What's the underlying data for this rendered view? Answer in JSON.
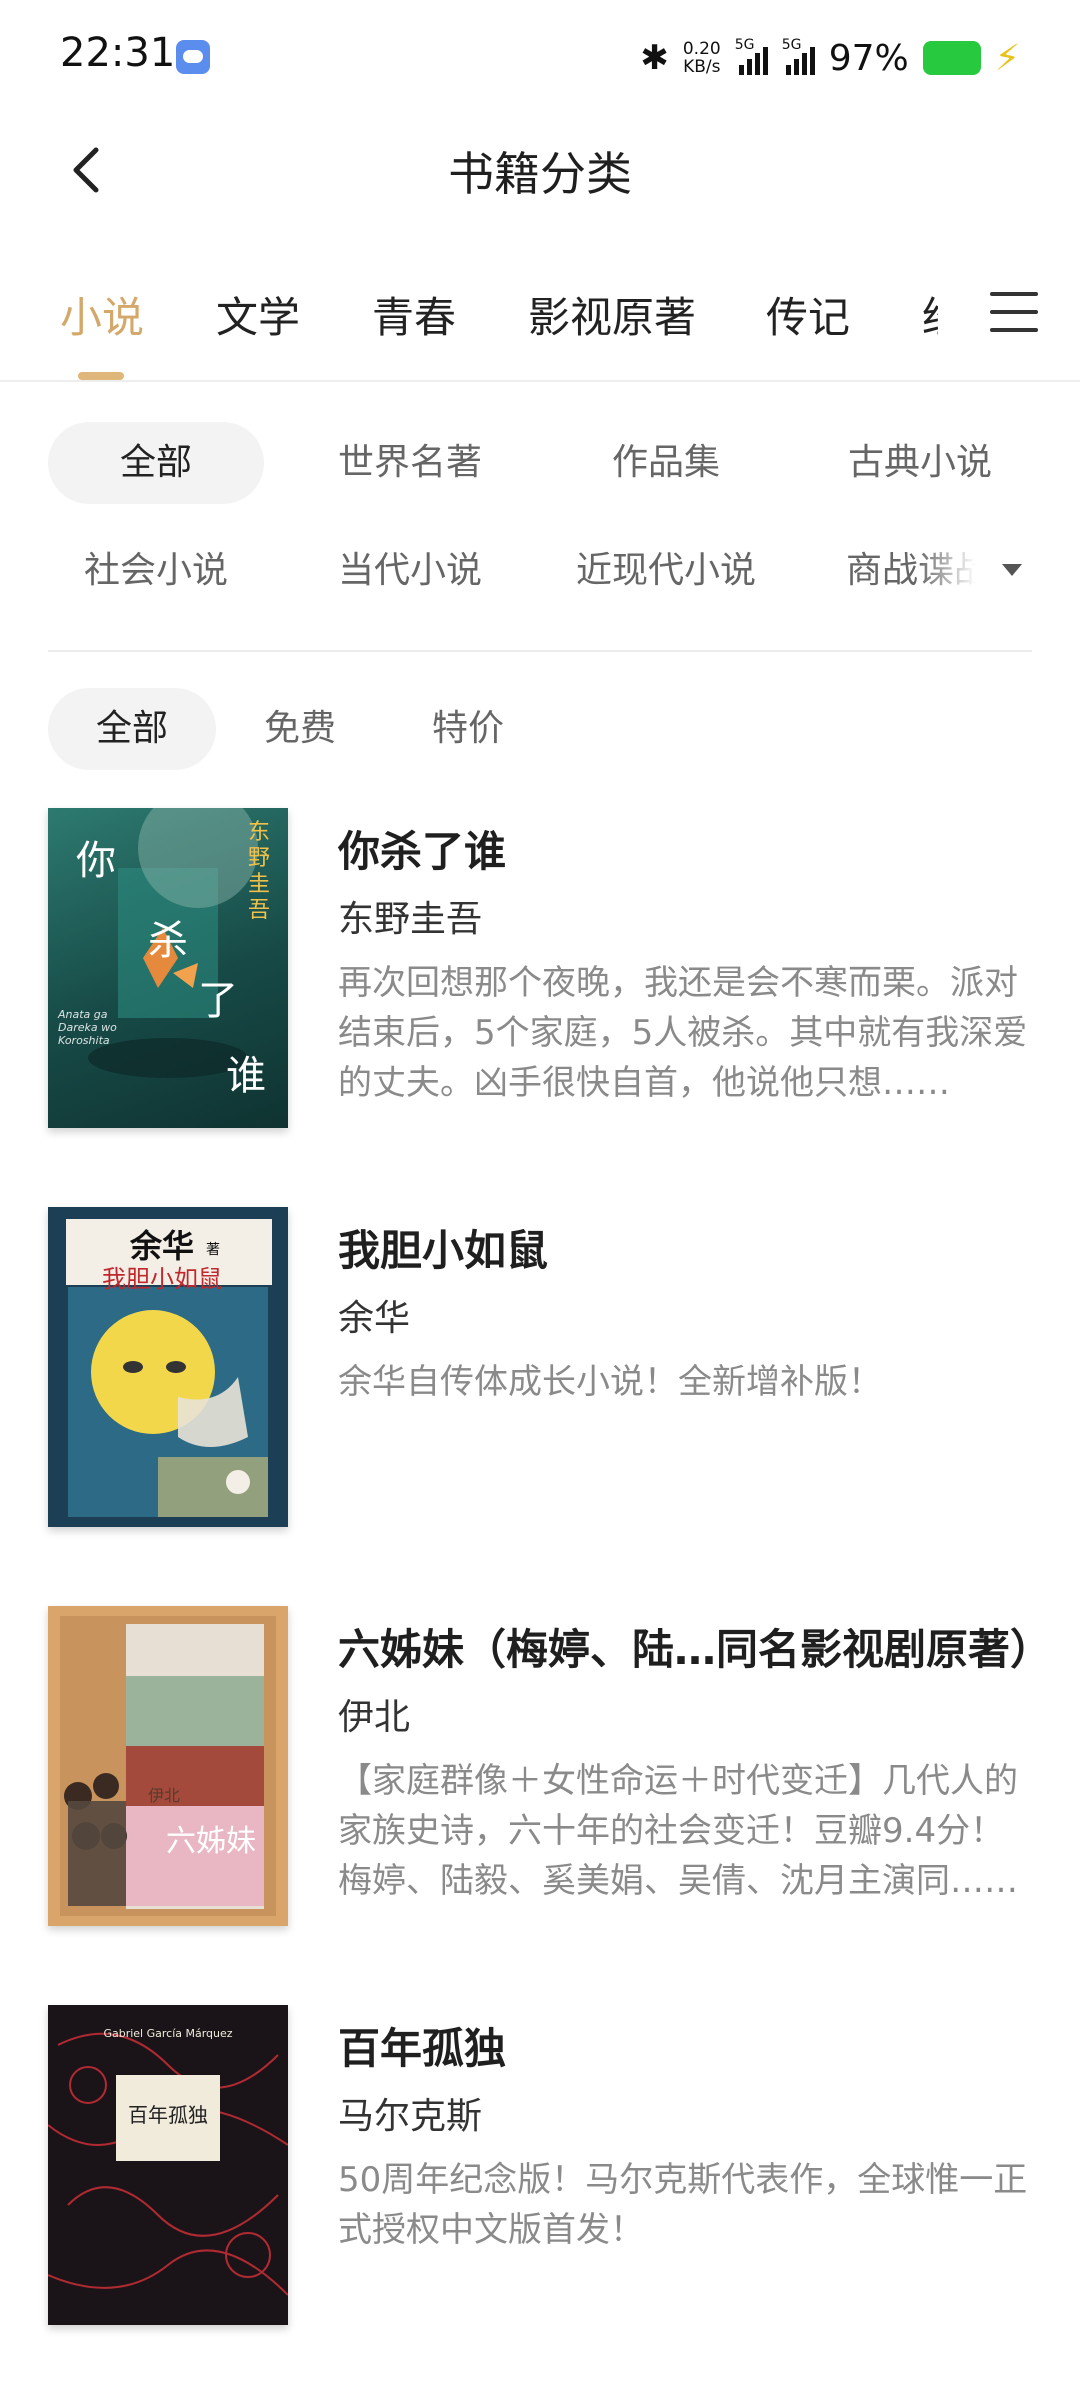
{
  "status_bar": {
    "time": "22:31",
    "net_speed_value": "0.20",
    "net_speed_unit": "KB/s",
    "sim1": "5G",
    "sim2": "5G",
    "battery_percent": "97%"
  },
  "header": {
    "title": "书籍分类"
  },
  "category_tabs": [
    {
      "label": "小说",
      "active": true
    },
    {
      "label": "文学",
      "active": false
    },
    {
      "label": "青春",
      "active": false
    },
    {
      "label": "影视原著",
      "active": false
    },
    {
      "label": "传记",
      "active": false
    },
    {
      "label": "经",
      "active": false
    }
  ],
  "sub_filters": [
    {
      "label": "全部",
      "active": true
    },
    {
      "label": "世界名著"
    },
    {
      "label": "作品集"
    },
    {
      "label": "古典小说"
    },
    {
      "label": "社会小说"
    },
    {
      "label": "当代小说"
    },
    {
      "label": "近现代小说"
    },
    {
      "label": "商战谍战"
    }
  ],
  "price_filters": [
    {
      "label": "全部",
      "active": true
    },
    {
      "label": "免费"
    },
    {
      "label": "特价"
    }
  ],
  "books": [
    {
      "title": "你杀了谁",
      "author": "东野圭吾",
      "description": "再次回想那个夜晚，我还是会不寒而栗。派对结束后，5个家庭，5人被杀。其中就有我深爱的丈夫。凶手很快自首，他说他只想……",
      "cover": {
        "char1": "你",
        "char2": "杀",
        "char3": "了",
        "char4": "谁",
        "author_vertical": "东野圭吾",
        "subtitle": "Anata ga Dareka wo Koroshita",
        "colors": {
          "bg": "#1f5a55",
          "accent": "#e58a3c"
        }
      }
    },
    {
      "title": "我胆小如鼠",
      "author": "余华",
      "description": "余华自传体成长小说！全新增补版！",
      "cover": {
        "author": "余华",
        "author_suffix": "著",
        "title": "我胆小如鼠",
        "colors": {
          "bg": "#1c3f56",
          "accent": "#f2d74a"
        }
      }
    },
    {
      "title": "六姊妹（梅婷、陆…同名影视剧原著）",
      "author": "伊北",
      "description": "【家庭群像＋女性命运＋时代变迁】几代人的家族史诗，六十年的社会变迁！豆瓣9.4分！梅婷、陆毅、奚美娟、吴倩、沈月主演同……",
      "cover": {
        "title": "六姊妹",
        "author": "伊北",
        "colors": {
          "bg": "#d9a56a",
          "accent": "#d06b8a"
        }
      }
    },
    {
      "title": "百年孤独",
      "author": "马尔克斯",
      "description": "50周年纪念版！马尔克斯代表作，全球惟一正式授权中文版首发！",
      "cover": {
        "title": "百年孤独",
        "author_en": "Gabriel García Márquez",
        "colors": {
          "bg": "#1a1418",
          "accent": "#b02a32"
        }
      }
    }
  ]
}
